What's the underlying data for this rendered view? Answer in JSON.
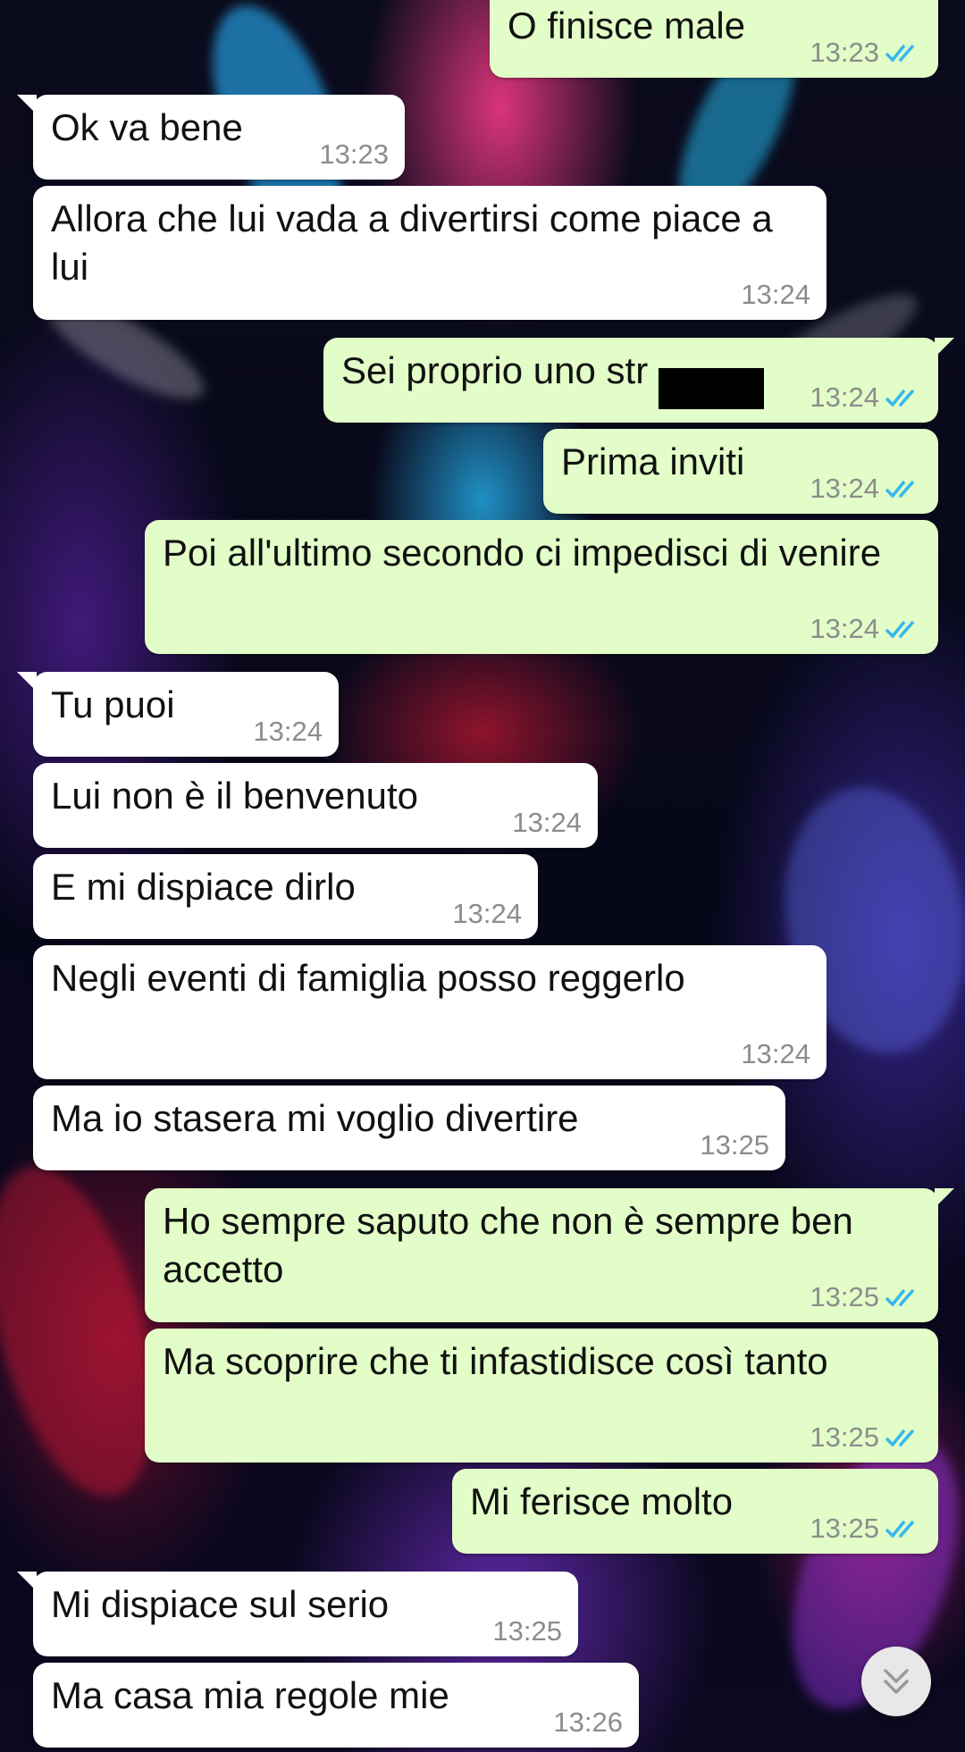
{
  "theme": {
    "incoming_bubble": "#ffffff",
    "outgoing_bubble": "#e2fdc7",
    "tick_color": "#34b7f1",
    "timestamp_color": "#8c8c8c"
  },
  "messages": [
    {
      "direction": "out",
      "text": "O finisce male",
      "time": "13:23",
      "status": "read"
    },
    {
      "direction": "in",
      "text": "Ok va bene",
      "time": "13:23"
    },
    {
      "direction": "in",
      "text": "Allora che lui vada a divertirsi come piace a lui",
      "time": "13:24"
    },
    {
      "direction": "out",
      "text": "Sei proprio uno str",
      "time": "13:24",
      "status": "read",
      "redacted": true
    },
    {
      "direction": "out",
      "text": "Prima inviti",
      "time": "13:24",
      "status": "read"
    },
    {
      "direction": "out",
      "text": "Poi all'ultimo secondo ci impedisci di venire",
      "time": "13:24",
      "status": "read"
    },
    {
      "direction": "in",
      "text": "Tu puoi",
      "time": "13:24"
    },
    {
      "direction": "in",
      "text": "Lui non è il benvenuto",
      "time": "13:24"
    },
    {
      "direction": "in",
      "text": "E mi dispiace dirlo",
      "time": "13:24"
    },
    {
      "direction": "in",
      "text": "Negli eventi di famiglia posso reggerlo",
      "time": "13:24"
    },
    {
      "direction": "in",
      "text": "Ma io stasera mi voglio divertire",
      "time": "13:25"
    },
    {
      "direction": "out",
      "text": "Ho sempre saputo che non è sempre ben accetto",
      "time": "13:25",
      "status": "read"
    },
    {
      "direction": "out",
      "text": "Ma scoprire che ti infastidisce così tanto",
      "time": "13:25",
      "status": "read"
    },
    {
      "direction": "out",
      "text": "Mi ferisce molto",
      "time": "13:25",
      "status": "read"
    },
    {
      "direction": "in",
      "text": "Mi dispiace sul serio",
      "time": "13:25"
    },
    {
      "direction": "in",
      "text": "Ma casa mia regole mie",
      "time": "13:26"
    }
  ],
  "scroll_button": {
    "icon": "chevron-double-down-icon"
  }
}
